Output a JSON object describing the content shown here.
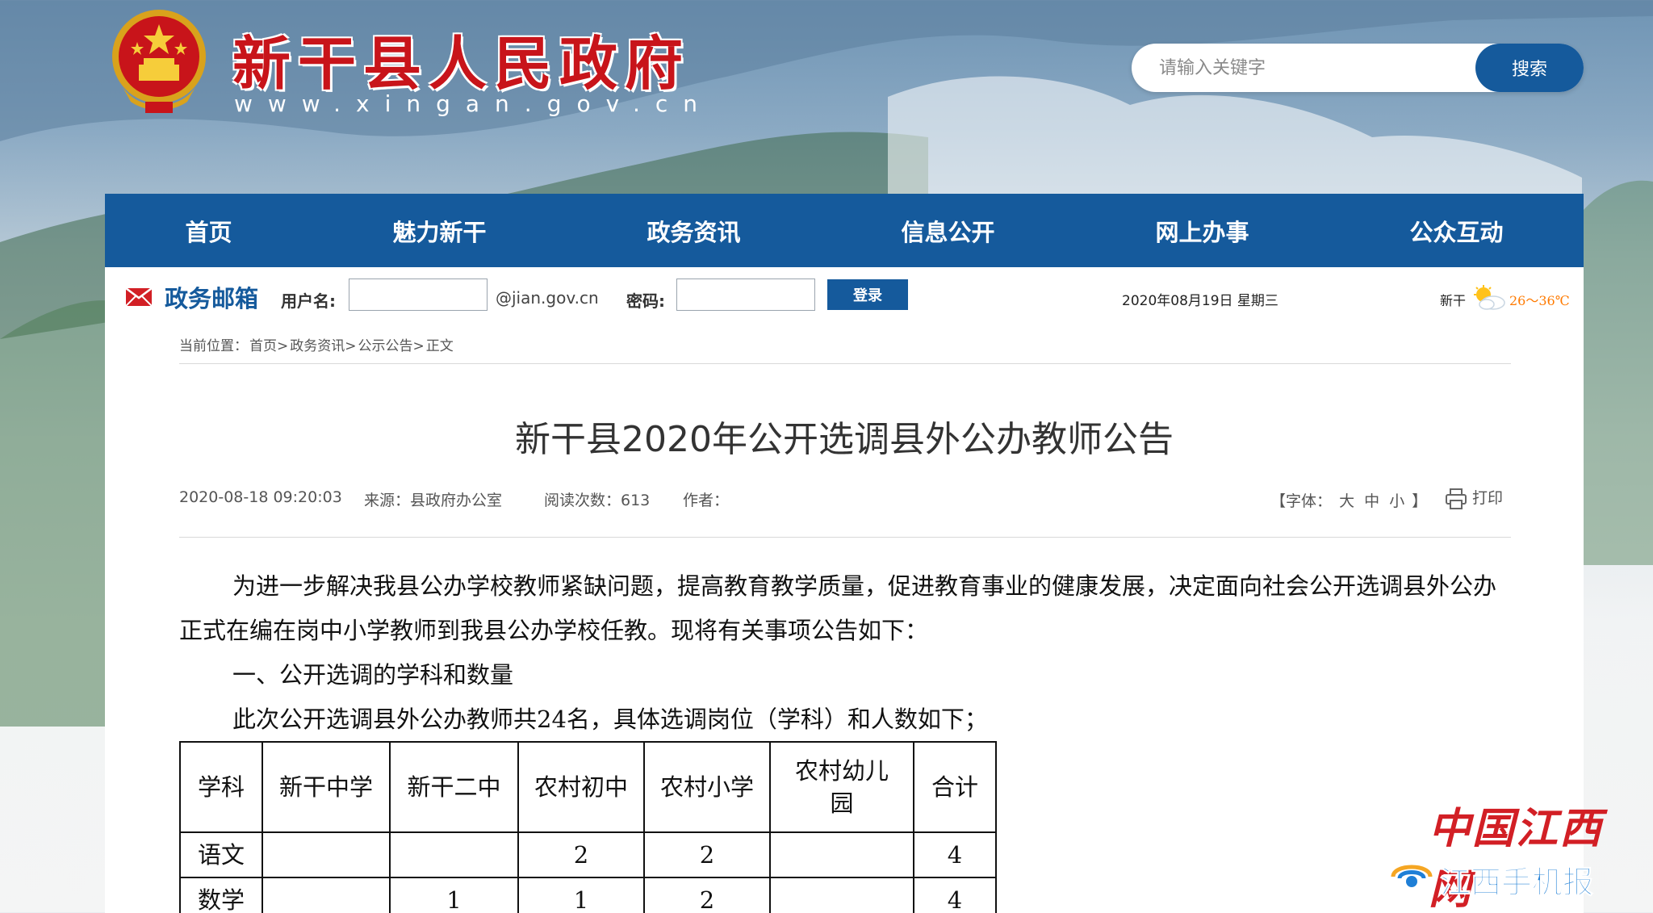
{
  "header": {
    "site_title": "新干县人民政府",
    "site_url": "www.xingan.gov.cn",
    "search_placeholder": "请输入关键字",
    "search_button": "搜索"
  },
  "nav": [
    "首页",
    "魅力新干",
    "政务资讯",
    "信息公开",
    "网上办事",
    "公众互动"
  ],
  "mailbox": {
    "title": "政务邮箱",
    "username_label": "用户名:",
    "domain": "@jian.gov.cn",
    "password_label": "密码:",
    "login_button": "登录"
  },
  "date_text": "2020年08月19日 星期三",
  "weather": {
    "city": "新干",
    "temperature": "26～36℃",
    "icon": "partly-cloudy-icon"
  },
  "breadcrumb": [
    "当前位置：",
    "首页>",
    "政务资讯>",
    "公示公告>",
    "正文"
  ],
  "article": {
    "title": "新干县2020年公开选调县外公办教师公告",
    "datetime": "2020-08-18 09:20:03",
    "source": "来源：县政府办公室",
    "reads": "阅读次数：613",
    "author": "作者：",
    "font_label": "【字体：",
    "font_sizes": [
      "大",
      "中",
      "小"
    ],
    "font_close": "】",
    "print": "打印",
    "paragraph1": "为进一步解决我县公办学校教师紧缺问题，提高教育教学质量，促进教育事业的健康发展，决定面向社会公开选调县外公办正式在编在岗中小学教师到我县公办学校任教。现将有关事项公告如下：",
    "heading1": "一、公开选调的学科和数量",
    "paragraph2": "此次公开选调县外公办教师共24名，具体选调岗位（学科）和人数如下；"
  },
  "table": {
    "headers": [
      "学科",
      "新干中学",
      "新干二中",
      "农村初中",
      "农村小学",
      "农村幼儿园",
      "合计"
    ],
    "rows": [
      [
        "语文",
        "",
        "",
        "2",
        "2",
        "",
        "4"
      ],
      [
        "数学",
        "",
        "1",
        "1",
        "2",
        "",
        "4"
      ]
    ]
  },
  "watermark": {
    "top": "中国江西网",
    "bottom": "江西手机报"
  },
  "colors": {
    "nav_blue": "#155a9c",
    "title_red": "#c8141a",
    "temp_orange": "#ff7a00"
  }
}
